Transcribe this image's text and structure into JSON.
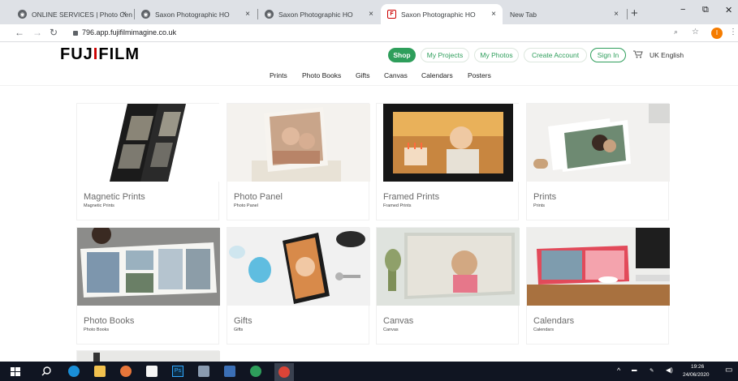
{
  "browser": {
    "tabs": [
      {
        "title": "ONLINE SERVICES | Photo Cen",
        "active": false
      },
      {
        "title": "Saxon Photographic HO",
        "active": false
      },
      {
        "title": "Saxon Photographic HO",
        "active": false
      },
      {
        "title": "Saxon Photographic HO",
        "active": true
      },
      {
        "title": "New Tab",
        "active": false
      }
    ],
    "tab_close": "×",
    "new_tab": "+",
    "window_controls": {
      "minimize": "−",
      "maximize": "⧉",
      "close": "✕"
    },
    "nav": {
      "back": "←",
      "forward": "→",
      "reload": "↻"
    },
    "url": "796.app.fujifilmimagine.co.uk",
    "addr_icons": {
      "search": "🔍",
      "star": "☆",
      "menu": "⋮"
    },
    "profile_initial": "I"
  },
  "site": {
    "logo_prefix": "FUJ",
    "logo_i": "I",
    "logo_suffix": "FILM",
    "top_nav": {
      "shop": "Shop",
      "my_projects": "My Projects",
      "my_photos": "My Photos",
      "create_account": "Create Account",
      "sign_in": "Sign In",
      "language": "UK English"
    },
    "menu": [
      "Prints",
      "Photo Books",
      "Gifts",
      "Canvas",
      "Calendars",
      "Posters"
    ],
    "products": [
      {
        "title": "Magnetic Prints",
        "sub": "Magnetic Prints"
      },
      {
        "title": "Photo Panel",
        "sub": "Photo Panel"
      },
      {
        "title": "Framed Prints",
        "sub": "Framed Prints"
      },
      {
        "title": "Prints",
        "sub": "Prints"
      },
      {
        "title": "Photo Books",
        "sub": "Photo Books"
      },
      {
        "title": "Gifts",
        "sub": "Gifts"
      },
      {
        "title": "Canvas",
        "sub": "Canvas"
      },
      {
        "title": "Calendars",
        "sub": "Calendars"
      }
    ],
    "colors": {
      "brand_green": "#2e9e5b",
      "logo_red": "#cc0000"
    }
  },
  "taskbar": {
    "time": "19:26",
    "date": "24/06/2020"
  }
}
